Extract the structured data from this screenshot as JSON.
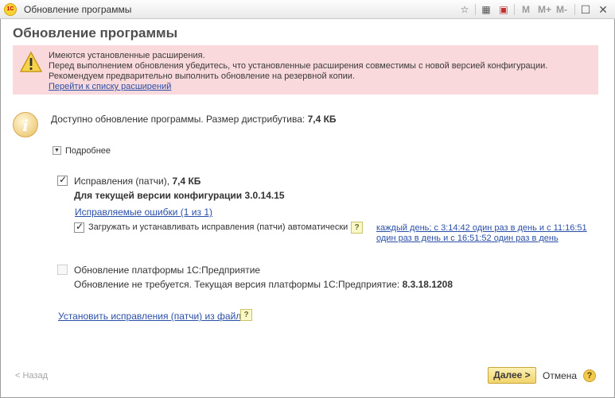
{
  "window": {
    "logo_text": "1С",
    "title": "Обновление программы"
  },
  "toolbar": {
    "m": "M",
    "m_plus": "M+",
    "m_minus": "M-"
  },
  "page_title": "Обновление программы",
  "warning": {
    "line1": "Имеются установленные расширения.",
    "line2": "Перед выполнением обновления убедитесь, что установленные расширения совместимы с новой версией конфигурации.",
    "line3": "Рекомендуем предварительно выполнить обновление на резервной копии.",
    "link": "Перейти к списку расширений"
  },
  "info": {
    "icon_letter": "i",
    "available_text": "Доступно обновление программы. Размер дистрибутива:",
    "size": "7,4 КБ"
  },
  "more": {
    "label": "Подробнее"
  },
  "patches": {
    "label": "Исправления (патчи),",
    "size": "7,4 КБ",
    "checked": true,
    "config_version_text": "Для текущей версии конфигурации 3.0.14.15",
    "errors_link": "Исправляемые ошибки (1 из 1)",
    "auto_label": "Загружать и устанавливать исправления (патчи) автоматически",
    "auto_checked": true,
    "schedule_line1": "каждый день; с 3:14:42 один раз в день и с 11:16:51",
    "schedule_line2": "один раз в день и с 16:51:52 один раз в день"
  },
  "platform": {
    "label": "Обновление платформы 1С:Предприятие",
    "checked": false,
    "status_text": "Обновление не требуется. Текущая версия платформы 1С:Предприятие:",
    "version": "8.3.18.1208"
  },
  "install_from_file_link": "Установить исправления (патчи) из файла",
  "help_mark": "?",
  "footer": {
    "back": "< Назад",
    "next": "Далее >",
    "cancel": "Отмена",
    "help": "?"
  }
}
